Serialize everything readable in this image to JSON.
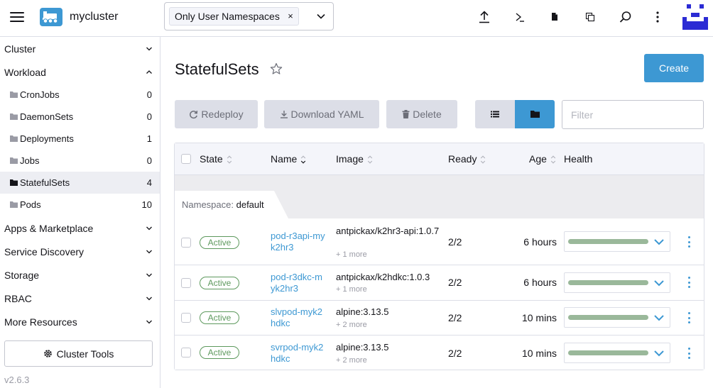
{
  "header": {
    "cluster_name": "mycluster",
    "namespace_chip": "Only User Namespaces",
    "chip_remove": "×",
    "icons": [
      "menu-icon",
      "cluster-icon",
      "upload-icon",
      "kubectl-shell-icon",
      "kubeconfig-file-icon",
      "copy-config-icon",
      "search-icon",
      "more-vertical-icon",
      "user-avatar"
    ]
  },
  "sidebar": {
    "groups": [
      {
        "label": "Cluster",
        "expanded": false
      },
      {
        "label": "Workload",
        "expanded": true
      },
      {
        "label": "Apps & Marketplace",
        "expanded": false
      },
      {
        "label": "Service Discovery",
        "expanded": false
      },
      {
        "label": "Storage",
        "expanded": false
      },
      {
        "label": "RBAC",
        "expanded": false
      },
      {
        "label": "More Resources",
        "expanded": false
      }
    ],
    "items": [
      {
        "label": "CronJobs",
        "count": "0"
      },
      {
        "label": "DaemonSets",
        "count": "0"
      },
      {
        "label": "Deployments",
        "count": "1"
      },
      {
        "label": "Jobs",
        "count": "0"
      },
      {
        "label": "StatefulSets",
        "count": "4",
        "active": true
      },
      {
        "label": "Pods",
        "count": "10"
      }
    ],
    "cluster_tools": "Cluster Tools",
    "version": "v2.6.3"
  },
  "main": {
    "title": "StatefulSets",
    "create_label": "Create",
    "redeploy_label": "Redeploy",
    "download_label": "Download YAML",
    "delete_label": "Delete",
    "filter_placeholder": "Filter"
  },
  "table": {
    "headers": {
      "state": "State",
      "name": "Name",
      "image": "Image",
      "ready": "Ready",
      "age": "Age",
      "health": "Health"
    },
    "group_label": "Namespace:",
    "group_value": "default",
    "rows": [
      {
        "state": "Active",
        "name": "pod-r3api-myk2hr3",
        "image": "antpickax/k2hr3-api:1.0.7",
        "image_more": "+ 1 more",
        "ready": "2/2",
        "age": "6 hours"
      },
      {
        "state": "Active",
        "name": "pod-r3dkc-myk2hr3",
        "image": "antpickax/k2hdkc:1.0.3",
        "image_more": "+ 1 more",
        "ready": "2/2",
        "age": "6 hours"
      },
      {
        "state": "Active",
        "name": "slvpod-myk2hdkc",
        "image": "alpine:3.13.5",
        "image_more": "+ 2 more",
        "ready": "2/2",
        "age": "10 mins"
      },
      {
        "state": "Active",
        "name": "svrpod-myk2hdkc",
        "image": "alpine:3.13.5",
        "image_more": "+ 2 more",
        "ready": "2/2",
        "age": "10 mins"
      }
    ]
  },
  "colors": {
    "primary": "#3d98d3",
    "active_green": "#5d995d",
    "health_bar": "#9ab89a",
    "disabled_button": "#dcdee7"
  }
}
